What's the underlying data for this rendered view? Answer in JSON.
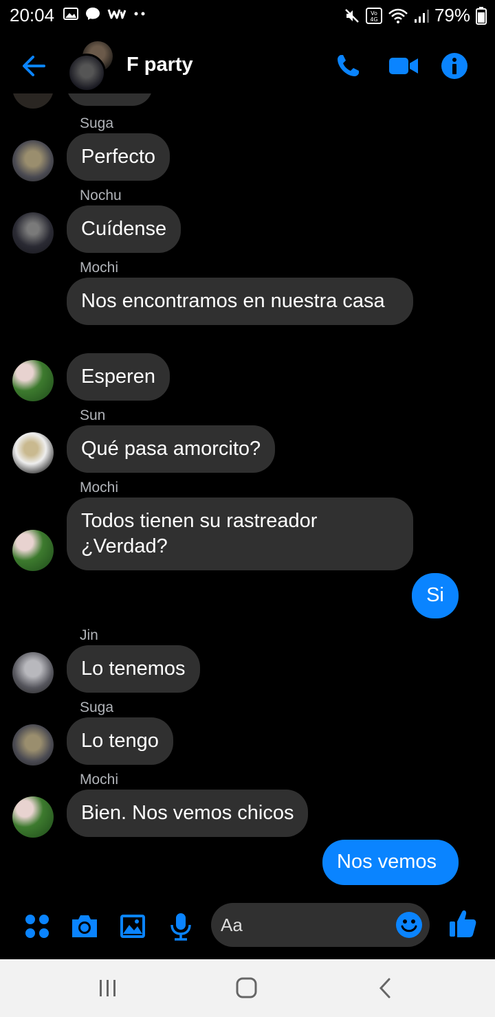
{
  "status_bar": {
    "time": "20:04",
    "battery": "79%"
  },
  "header": {
    "title": "F party"
  },
  "messages": [
    {
      "sender": "Suga",
      "text": "Perfecto"
    },
    {
      "sender": "Nochu",
      "text": "Cuídense"
    },
    {
      "sender": "Mochi",
      "text": "Nos encontramos en nuestra casa"
    },
    {
      "sender": "",
      "text": "Esperen"
    },
    {
      "sender": "Sun",
      "text": "Qué pasa amorcito?"
    },
    {
      "sender": "Mochi",
      "text": "Todos tienen su rastreador ¿Verdad?"
    },
    {
      "sender": "",
      "text": "Si"
    },
    {
      "sender": "Jin",
      "text": "Lo tenemos"
    },
    {
      "sender": "Suga",
      "text": "Lo tengo"
    },
    {
      "sender": "Mochi",
      "text": "Bien. Nos vemos chicos"
    },
    {
      "sender": "",
      "text": "Nos vemos"
    }
  ],
  "composer": {
    "placeholder": "Aa"
  },
  "colors": {
    "accent": "#0a84ff",
    "bubble": "#303030",
    "background": "#000000"
  },
  "icons": [
    "back-arrow-icon",
    "phone-icon",
    "video-icon",
    "info-icon",
    "apps-icon",
    "camera-icon",
    "gallery-icon",
    "mic-icon",
    "emoji-icon",
    "like-icon",
    "recent-apps-icon",
    "home-icon",
    "nav-back-icon"
  ]
}
